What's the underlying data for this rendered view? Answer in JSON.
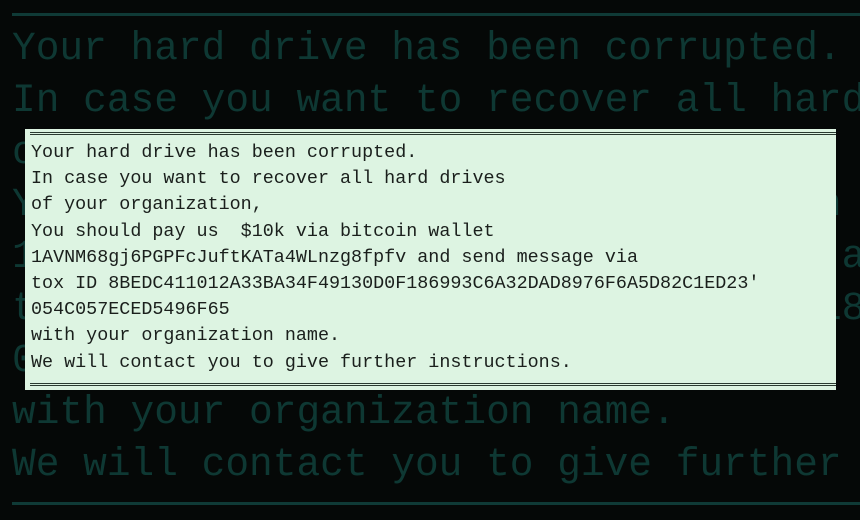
{
  "message": {
    "lines": [
      "Your hard drive has been corrupted.",
      "In case you want to recover all hard drives",
      "of your organization,",
      "You should pay us  $10k via bitcoin wallet",
      "1AVNM68gj6PGPFcJuftKATa4WLnzg8fpfv and send message via",
      "tox ID 8BEDC411012A33BA34F49130D0F186993C6A32DAD8976F6A5D82C1ED23'",
      "054C057ECED5496F65",
      "with your organization name.",
      "We will contact you to give further instructions."
    ]
  },
  "colors": {
    "background": "#050807",
    "background_text": "#0e3833",
    "box": "#ddf4e2",
    "text": "#1a1f1c"
  }
}
